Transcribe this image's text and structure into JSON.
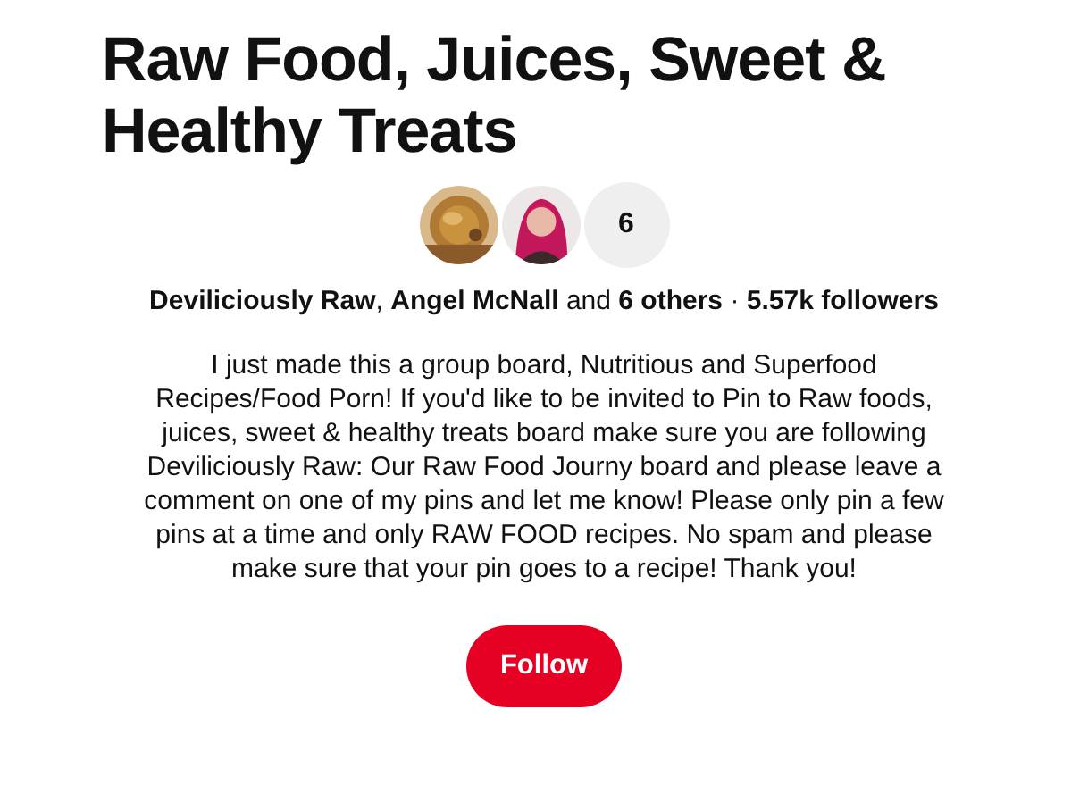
{
  "board": {
    "title": "Raw Food, Juices, Sweet & Healthy Treats",
    "more_count": "6",
    "stats": "**Deviliciously Raw**, **Angel McNall** and **6 others** · **5.57k followers**",
    "description": "I just made this a group board, Nutritious and Superfood Recipes/Food Porn! If you'd like to be invited to Pin to Raw foods, juices, sweet & healthy treats board make sure you are following Deviliciously Raw: Our Raw Food Journy board and please leave a comment on one of my pins and let me know! Please only pin a few pins at a time and only RAW FOOD recipes. No spam and please make sure that your pin goes to a recipe! Thank you!",
    "follow_button": "Follow"
  }
}
